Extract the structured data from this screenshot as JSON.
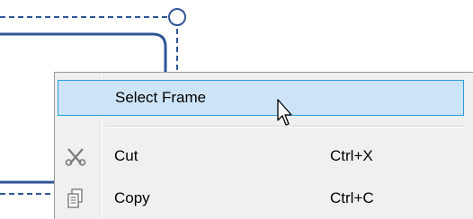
{
  "context_menu": {
    "items": [
      {
        "label": "Select Frame",
        "shortcut": "",
        "icon": "",
        "highlighted": true
      },
      {
        "label": "Cut",
        "shortcut": "Ctrl+X",
        "icon": "scissors-icon",
        "highlighted": false
      },
      {
        "label": "Copy",
        "shortcut": "Ctrl+C",
        "icon": "copy-icon",
        "highlighted": false
      }
    ]
  },
  "colors": {
    "connector_line": "#2f5597",
    "highlight_bg": "#cde4f7",
    "highlight_border": "#26a0da",
    "menu_bg": "#f0f0f0"
  }
}
